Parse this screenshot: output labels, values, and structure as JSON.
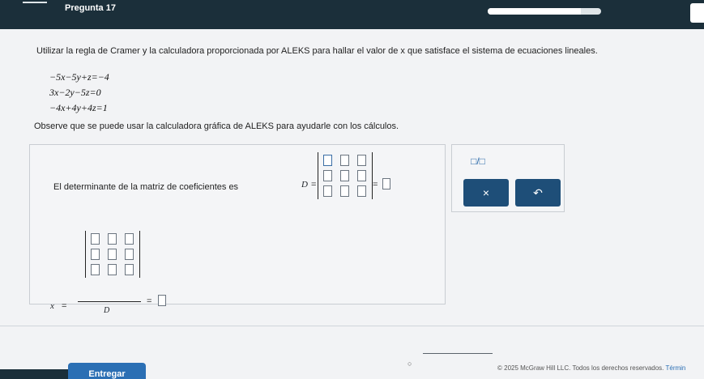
{
  "header": {
    "question_title": "Pregunta 17",
    "progress_fraction": 0.82
  },
  "instructions": "Utilizar la regla de Cramer y la calculadora proporcionada por ALEKS para hallar el valor de x que satisface el sistema de ecuaciones lineales.",
  "equations": [
    "−5x−5y+z=−4",
    "3x−2y−5z=0",
    "−4x+4y+4z=1"
  ],
  "observe_note": "Observe que se puede usar la calculadora gráfica de ALEKS para ayudarle con los cálculos.",
  "determinant": {
    "label": "El determinante de la matriz de coeficientes es",
    "variable": "D",
    "equals": "=",
    "equals_result": "="
  },
  "cramer": {
    "variable": "x",
    "equals": "=",
    "denominator": "D",
    "equals_result": "="
  },
  "tools": {
    "fraction_label": "□/□",
    "clear_label": "×",
    "undo_label": "↶"
  },
  "footer": {
    "submit_label": "Entregar",
    "copyright": "© 2025 McGraw Hill LLC. Todos los derechos reservados.",
    "terms_label": "Términ"
  },
  "colors": {
    "top_bar": "#1b2f3a",
    "button": "#1e4e78",
    "submit": "#2b6fb4"
  }
}
